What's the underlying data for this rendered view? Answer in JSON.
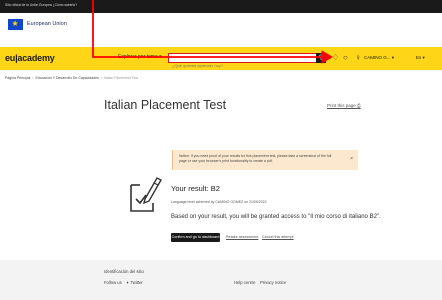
{
  "colors": {
    "brand_yellow": "#ffd617",
    "search_border": "#d71920",
    "annotation_red": "#ff0000",
    "notice_bg": "#fbe8cf"
  },
  "topbar": {
    "text": "Sitio oficial de la Unión Europea ¿Cómo saberlo?"
  },
  "eu_header": {
    "logo_icon": "eu-flag-icon",
    "label": "European Union"
  },
  "nav": {
    "brand": "eu|academy",
    "explore": "Explorar por tema ▾",
    "search_placeholder": "¿Qué quieres aprender hoy?",
    "search_icon": "search-icon",
    "notifications_icon": "bell-icon",
    "chat_icon": "chat-icon",
    "user_icon": "user-icon",
    "user_name": "CAMINO G... ▾",
    "language": "Es ▾"
  },
  "breadcrumb": {
    "items": [
      "Página Principal",
      "Educación Y Desarrollo De Capacidades"
    ],
    "current": "Italian Placement Test"
  },
  "page": {
    "title": "Italian Placement Test",
    "print_link": "Print this page ⎙"
  },
  "notice": {
    "text": "Notice: If you need proof of your results for this placement test, please take a screenshot of the full page or use your browser's print functionality to create a pdf.",
    "close": "×"
  },
  "result": {
    "icon": "certificate-icon",
    "title": "Your result: B2",
    "achieved": "Language level achieved by CAMINO GOMEZ on 21/09/2022",
    "access": "Based on your result, you will be granted access to \"Il mio corso di italiano B2\".",
    "confirm_button": "Confirm and go to dashboard",
    "retake_link": "Retake assessment",
    "cancel_link": "Cancel this attempt"
  },
  "footer": {
    "id_label": "Identificación del sitio",
    "follow_label": "Follow us",
    "twitter_icon": "twitter-icon",
    "twitter_label": "Twitter",
    "help_link": "Help centre",
    "privacy_link": "Privacy notice"
  }
}
